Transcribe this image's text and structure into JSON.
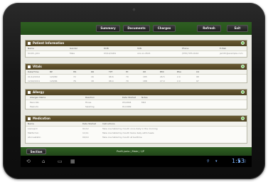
{
  "topbar": {
    "tabs": [
      "Summary",
      "Documents",
      "Charges"
    ],
    "refresh_label": "Refresh",
    "exit_label": "Exit"
  },
  "patient_info": {
    "title": "Patient Information",
    "columns": [
      "Name",
      "Gender",
      "DOB",
      "SSN",
      "Phone",
      "E-Mail"
    ],
    "row": [
      "Smith, John",
      "Male",
      "03/14/1961",
      "xxx-xx-4521",
      "(555) 555-0142",
      "jsmith@example.com"
    ]
  },
  "vitals": {
    "title": "Vitals",
    "columns": [
      "Date/Time",
      "BP",
      "HR",
      "RR",
      "TPT",
      "Ht",
      "Wt",
      "BMI",
      "BSA",
      "O2"
    ],
    "rows": [
      [
        "01/12/2012",
        "120/80",
        "72",
        "16",
        "98.6",
        "70",
        "185",
        "26.5",
        "2.0",
        "98"
      ],
      [
        "12/02/2011",
        "126/84",
        "76",
        "18",
        "98.4",
        "70",
        "188",
        "27.0",
        "2.0",
        "97"
      ]
    ]
  },
  "allergy": {
    "title": "Allergy",
    "columns": [
      "Allergen Name",
      "Reaction",
      "Date Started",
      "Notes"
    ],
    "rows": [
      [
        "Penicillin",
        "Hives",
        "05/2004",
        "Mild"
      ],
      [
        "Peanuts",
        "Swelling",
        "01/1999",
        ""
      ]
    ]
  },
  "medication": {
    "title": "Medication",
    "columns": [
      "Name",
      "Date Started",
      "Instructions"
    ],
    "rows": [
      {
        "name": "Lisinopril",
        "date": "01/12",
        "inst": "Take one tablet by mouth once daily in the morning"
      },
      {
        "name": "Metformin",
        "date": "11/11",
        "inst": "Take one tablet by mouth twice daily with meals"
      },
      {
        "name": "Atorvastatin",
        "date": "09/10",
        "inst": "Take one tablet by mouth at bedtime"
      }
    ]
  },
  "bottombar": {
    "section_label": "Section",
    "profile_text": "Profil.junio | Male | 1/P"
  },
  "navbar": {
    "clock": "1:53"
  },
  "colors": {
    "header_green": "#2f5f22",
    "section_brown": "#5a4c28",
    "toggle_green": "#7fc35b",
    "clock_blue": "#7fb5ff"
  }
}
